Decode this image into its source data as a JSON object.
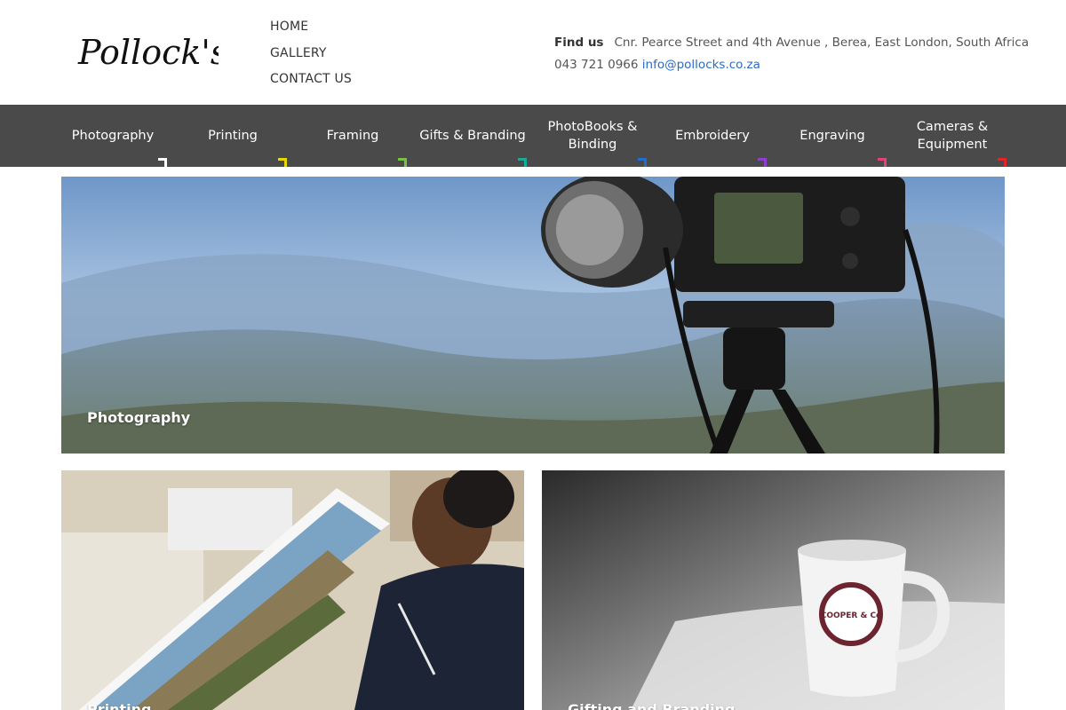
{
  "brand": {
    "name": "Pollock's"
  },
  "topnav": [
    {
      "label": "HOME"
    },
    {
      "label": "GALLERY"
    },
    {
      "label": "CONTACT US"
    }
  ],
  "contact": {
    "find_label": "Find us",
    "address": "Cnr. Pearce Street and 4th Avenue , Berea, East London, South Africa",
    "phone": "043 721 0966",
    "email": "info@pollocks.co.za"
  },
  "categories": [
    {
      "label": "Photography",
      "color": "#ffffff"
    },
    {
      "label": "Printing",
      "color": "#e6d700"
    },
    {
      "label": "Framing",
      "color": "#7ac143"
    },
    {
      "label": "Gifts & Branding",
      "color": "#18a99a"
    },
    {
      "label": "PhotoBooks & Binding",
      "color": "#1f6fd0"
    },
    {
      "label": "Embroidery",
      "color": "#8e3fd0"
    },
    {
      "label": "Engraving",
      "color": "#e2427d"
    },
    {
      "label": "Cameras & Equipment",
      "color": "#e0262a"
    }
  ],
  "tiles": {
    "hero": {
      "label": "Photography"
    },
    "left": {
      "label": "Printing"
    },
    "right": {
      "label": "Gifting and Branding",
      "mug_text": "COOPER & Co"
    }
  },
  "colors": {
    "header_bg": "#ffffff",
    "bar_bg": "#4a4a4a",
    "link": "#2a6bc7"
  }
}
